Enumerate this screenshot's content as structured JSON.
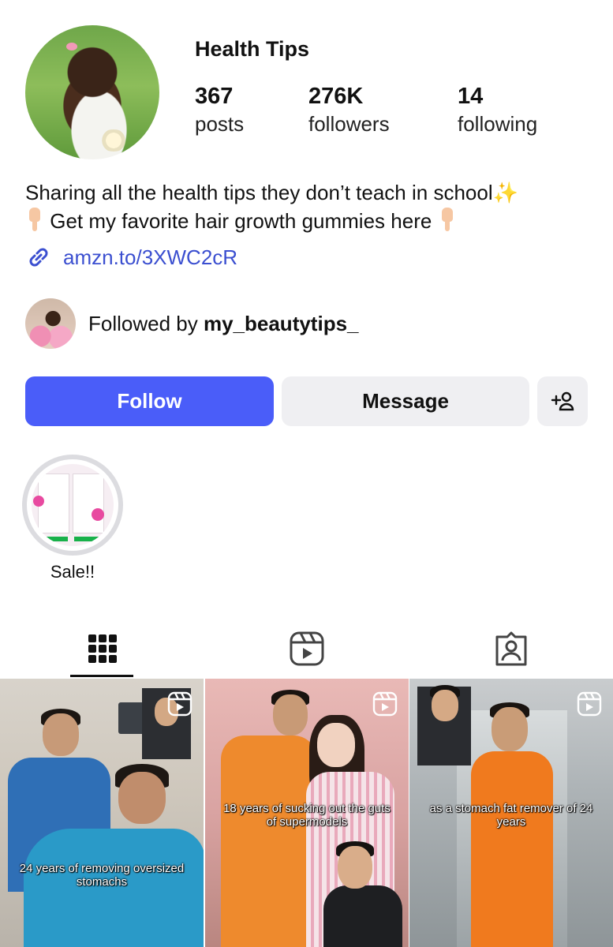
{
  "profile": {
    "username": "Health Tips",
    "stats": [
      {
        "value": "367",
        "label": "posts"
      },
      {
        "value": "276K",
        "label": "followers"
      },
      {
        "value": "14",
        "label": "following"
      }
    ],
    "bio_line1": "Sharing all the health tips they don’t teach in school",
    "bio_line1_emoji": "✨",
    "bio_line2": "Get my favorite hair growth gummies here",
    "link": "amzn.to/3XWC2cR",
    "followed_by_prefix": "Followed by ",
    "followed_by_user": "my_beautytips_"
  },
  "actions": {
    "follow_label": "Follow",
    "message_label": "Message",
    "add_icon": "add-person-icon"
  },
  "highlights": [
    {
      "label": "Sale!!"
    }
  ],
  "tabs": [
    {
      "icon": "grid-icon",
      "active": true
    },
    {
      "icon": "reels-icon",
      "active": false
    },
    {
      "icon": "tagged-icon",
      "active": false
    }
  ],
  "posts": [
    {
      "caption": "24 years of removing oversized stomachs",
      "type": "reel"
    },
    {
      "caption": "18 years of sucking out the guts of supermodels",
      "type": "reel"
    },
    {
      "caption": "as a stomach fat remover of 24 years",
      "type": "reel"
    }
  ],
  "colors": {
    "accent": "#4a5df9",
    "link": "#3b4fd0",
    "button_secondary": "#efeff2"
  }
}
